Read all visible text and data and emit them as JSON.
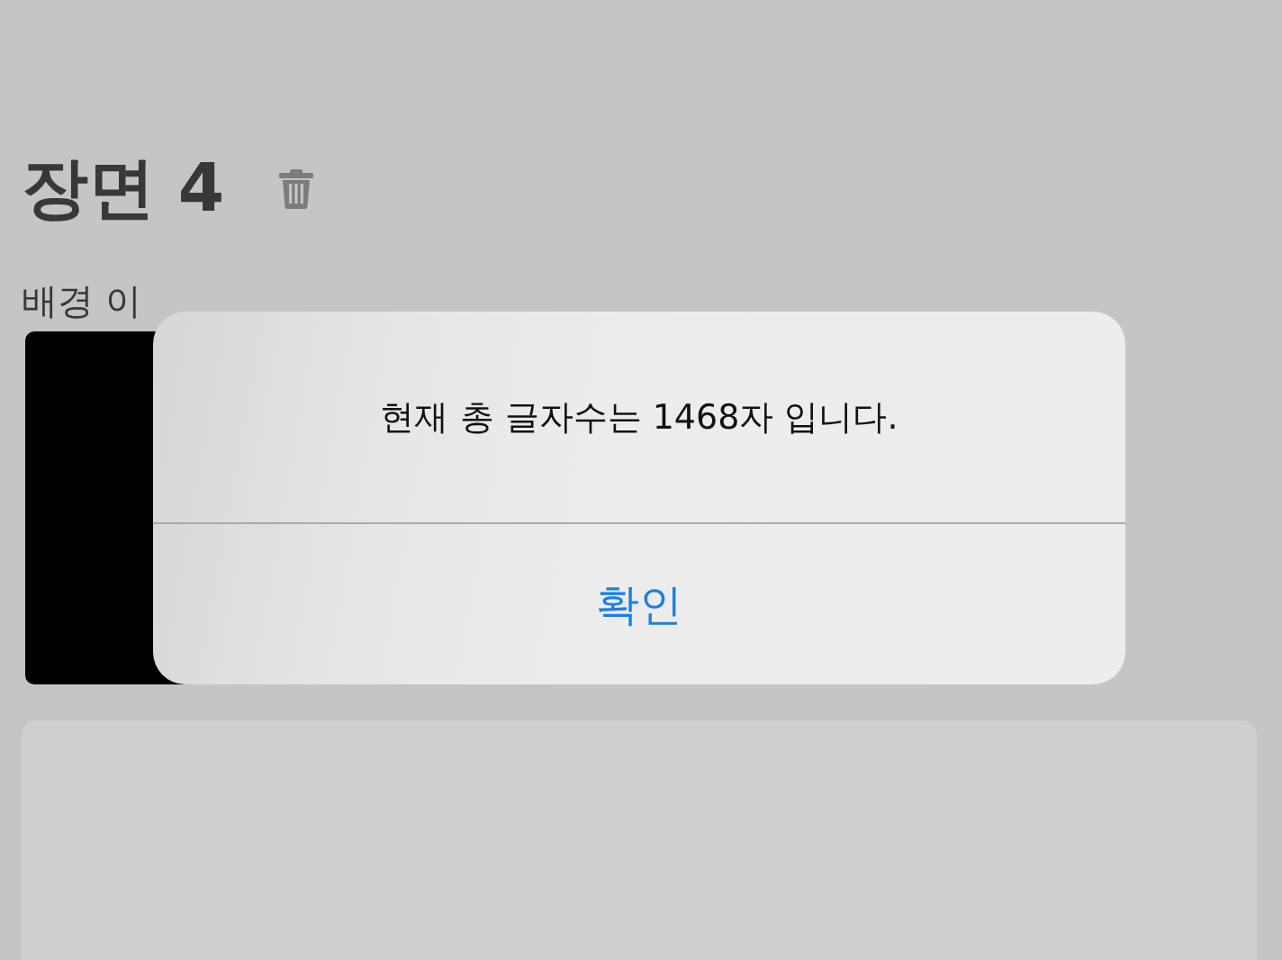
{
  "scene": {
    "title": "장면 4",
    "background_label": "배경 이"
  },
  "alert": {
    "message": "현재 총 글자수는 1468자 입니다.",
    "buttons": [
      "확인"
    ]
  }
}
